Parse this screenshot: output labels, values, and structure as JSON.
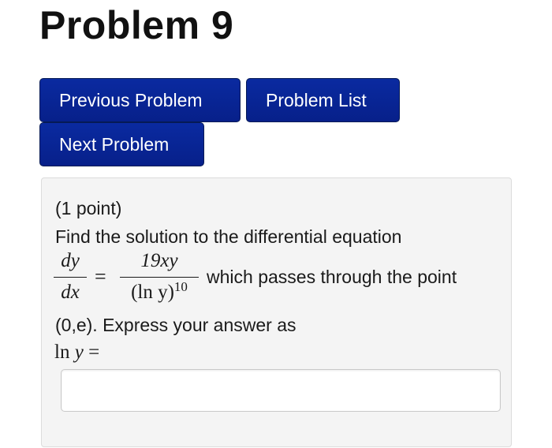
{
  "page": {
    "title": "Problem 9"
  },
  "nav": {
    "previous_label": "Previous Problem",
    "list_label": "Problem List",
    "next_label": "Next Problem"
  },
  "problem": {
    "points": "(1 point)",
    "prompt": "Find the solution to the differential equation",
    "equation": {
      "lhs_numerator": "dy",
      "lhs_denominator": "dx",
      "equals": "=",
      "rhs_numerator": "19xy",
      "rhs_denominator_base": "(ln y)",
      "rhs_denominator_exponent": "10"
    },
    "condition": "which passes through the point",
    "express": "(0,e). Express your answer as",
    "answer_prefix_fn": "ln",
    "answer_prefix_var": "y",
    "answer_prefix_equals": "=",
    "answer_value": "",
    "answer_placeholder": ""
  },
  "colors": {
    "button_bg": "#07208a",
    "button_text": "#ffffff",
    "panel_bg": "#f4f4f4",
    "panel_border": "#dcdcdc"
  }
}
